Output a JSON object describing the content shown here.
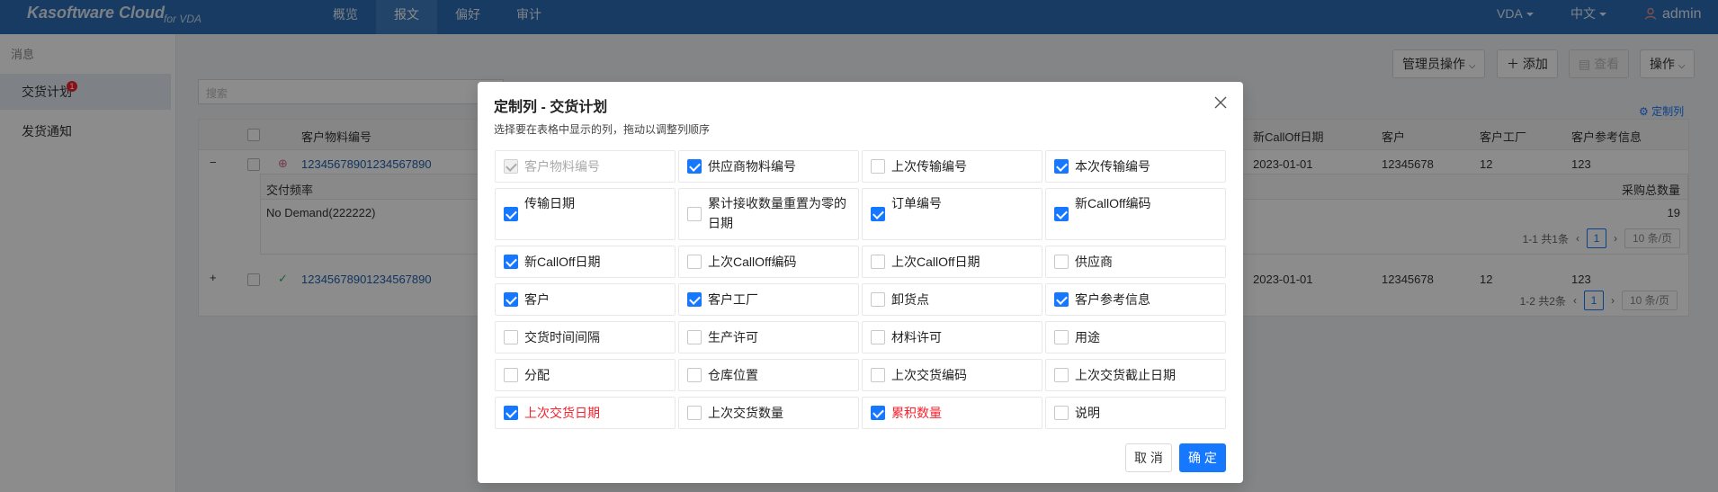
{
  "header": {
    "brand": "Kasoftware Cloud",
    "brand_sub": "for VDA",
    "nav": [
      "概览",
      "报文",
      "偏好",
      "审计"
    ],
    "active_nav": 1,
    "vda_label": "VDA",
    "lang_label": "中文",
    "user": "admin"
  },
  "sidebar": {
    "group": "消息",
    "items": [
      {
        "label": "交货计划",
        "badge": "1"
      },
      {
        "label": "发货通知"
      }
    ]
  },
  "toolbar": {
    "admin_ops": "管理员操作",
    "add": "添加",
    "view": "查看",
    "ops": "操作",
    "search_placeholder": "搜索",
    "customize_columns": "定制列"
  },
  "table": {
    "headers": {
      "material": "客户物料编号",
      "calloff_date": "新CallOff日期",
      "customer": "客户",
      "plant": "客户工厂",
      "ref": "客户参考信息"
    },
    "rows": [
      {
        "expand": "−",
        "material": "12345678901234567890",
        "calloff_date": "2023-01-01",
        "customer": "12345678",
        "plant": "12",
        "ref": "123"
      },
      {
        "expand": "+",
        "material": "12345678901234567890",
        "calloff_date": "2023-01-01",
        "customer": "12345678",
        "plant": "12",
        "ref": "123"
      }
    ],
    "sub": {
      "col1": "交付频率",
      "col2": "采购总数量",
      "val1": "No Demand(222222)",
      "val2": "19",
      "pager_text": "1-1 共1条",
      "page": "1",
      "page_size": "10 条/页"
    },
    "pager_text": "1-2 共2条",
    "page": "1",
    "page_size": "10 条/页"
  },
  "modal": {
    "title": "定制列 - 交货计划",
    "description": "选择要在表格中显示的列，拖动以调整列顺序",
    "options": [
      {
        "label": "客户物料编号",
        "state": "disabled"
      },
      {
        "label": "供应商物料编号",
        "state": "checked"
      },
      {
        "label": "上次传输编号",
        "state": "unchecked"
      },
      {
        "label": "本次传输编号",
        "state": "checked"
      },
      {
        "label": "传输日期",
        "state": "checked"
      },
      {
        "label": "累计接收数量重置为零的日期",
        "state": "unchecked"
      },
      {
        "label": "订单编号",
        "state": "checked"
      },
      {
        "label": "新CallOff编码",
        "state": "checked"
      },
      {
        "label": "新CallOff日期",
        "state": "checked"
      },
      {
        "label": "上次CallOff编码",
        "state": "unchecked"
      },
      {
        "label": "上次CallOff日期",
        "state": "unchecked"
      },
      {
        "label": "供应商",
        "state": "unchecked"
      },
      {
        "label": "客户",
        "state": "checked"
      },
      {
        "label": "客户工厂",
        "state": "checked"
      },
      {
        "label": "卸货点",
        "state": "unchecked"
      },
      {
        "label": "客户参考信息",
        "state": "checked"
      },
      {
        "label": "交货时间间隔",
        "state": "unchecked"
      },
      {
        "label": "生产许可",
        "state": "unchecked"
      },
      {
        "label": "材料许可",
        "state": "unchecked"
      },
      {
        "label": "用途",
        "state": "unchecked"
      },
      {
        "label": "分配",
        "state": "unchecked"
      },
      {
        "label": "仓库位置",
        "state": "unchecked"
      },
      {
        "label": "上次交货编码",
        "state": "unchecked"
      },
      {
        "label": "上次交货截止日期",
        "state": "unchecked"
      },
      {
        "label": "上次交货日期",
        "state": "checked",
        "red": true
      },
      {
        "label": "上次交货数量",
        "state": "unchecked"
      },
      {
        "label": "累积数量",
        "state": "checked",
        "red": true
      },
      {
        "label": "说明",
        "state": "unchecked"
      }
    ],
    "cancel": "取 消",
    "ok": "确 定"
  },
  "colors": {
    "header_bg": "#2a6cb3",
    "primary": "#1677ff",
    "danger": "#f5222d"
  }
}
